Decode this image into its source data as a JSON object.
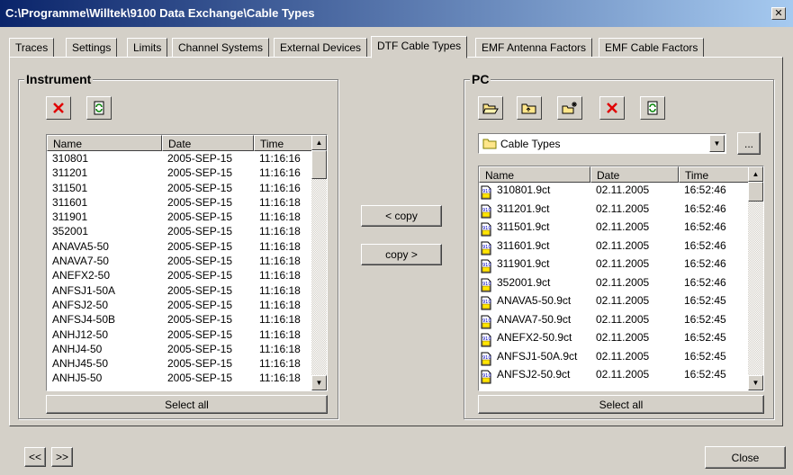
{
  "window": {
    "title": "C:\\Programme\\Willtek\\9100 Data Exchange\\Cable Types",
    "close_glyph": "✕"
  },
  "tabs": [
    {
      "label": "Traces"
    },
    {
      "label": "Settings"
    },
    {
      "label": "Limits"
    },
    {
      "label": "Channel Systems"
    },
    {
      "label": "External Devices"
    },
    {
      "label": "DTF Cable Types"
    },
    {
      "label": "EMF Antenna Factors"
    },
    {
      "label": "EMF Cable Factors"
    }
  ],
  "active_tab": "DTF Cable Types",
  "instrument": {
    "title": "Instrument",
    "columns": {
      "name": "Name",
      "date": "Date",
      "time": "Time"
    },
    "rows": [
      {
        "name": "310801",
        "date": "2005-SEP-15",
        "time": "11:16:16"
      },
      {
        "name": "311201",
        "date": "2005-SEP-15",
        "time": "11:16:16"
      },
      {
        "name": "311501",
        "date": "2005-SEP-15",
        "time": "11:16:16"
      },
      {
        "name": "311601",
        "date": "2005-SEP-15",
        "time": "11:16:18"
      },
      {
        "name": "311901",
        "date": "2005-SEP-15",
        "time": "11:16:18"
      },
      {
        "name": "352001",
        "date": "2005-SEP-15",
        "time": "11:16:18"
      },
      {
        "name": "ANAVA5-50",
        "date": "2005-SEP-15",
        "time": "11:16:18"
      },
      {
        "name": "ANAVA7-50",
        "date": "2005-SEP-15",
        "time": "11:16:18"
      },
      {
        "name": "ANEFX2-50",
        "date": "2005-SEP-15",
        "time": "11:16:18"
      },
      {
        "name": "ANFSJ1-50A",
        "date": "2005-SEP-15",
        "time": "11:16:18"
      },
      {
        "name": "ANFSJ2-50",
        "date": "2005-SEP-15",
        "time": "11:16:18"
      },
      {
        "name": "ANFSJ4-50B",
        "date": "2005-SEP-15",
        "time": "11:16:18"
      },
      {
        "name": "ANHJ12-50",
        "date": "2005-SEP-15",
        "time": "11:16:18"
      },
      {
        "name": "ANHJ4-50",
        "date": "2005-SEP-15",
        "time": "11:16:18"
      },
      {
        "name": "ANHJ45-50",
        "date": "2005-SEP-15",
        "time": "11:16:18"
      },
      {
        "name": "ANHJ5-50",
        "date": "2005-SEP-15",
        "time": "11:16:18"
      }
    ],
    "select_all": "Select all"
  },
  "transfer": {
    "copy_left": "< copy",
    "copy_right": "copy >"
  },
  "pc": {
    "title": "PC",
    "folder": "Cable Types",
    "browse": "...",
    "columns": {
      "name": "Name",
      "date": "Date",
      "time": "Time"
    },
    "rows": [
      {
        "name": "310801.9ct",
        "date": "02.11.2005",
        "time": "16:52:46"
      },
      {
        "name": "311201.9ct",
        "date": "02.11.2005",
        "time": "16:52:46"
      },
      {
        "name": "311501.9ct",
        "date": "02.11.2005",
        "time": "16:52:46"
      },
      {
        "name": "311601.9ct",
        "date": "02.11.2005",
        "time": "16:52:46"
      },
      {
        "name": "311901.9ct",
        "date": "02.11.2005",
        "time": "16:52:46"
      },
      {
        "name": "352001.9ct",
        "date": "02.11.2005",
        "time": "16:52:46"
      },
      {
        "name": "ANAVA5-50.9ct",
        "date": "02.11.2005",
        "time": "16:52:45"
      },
      {
        "name": "ANAVA7-50.9ct",
        "date": "02.11.2005",
        "time": "16:52:45"
      },
      {
        "name": "ANEFX2-50.9ct",
        "date": "02.11.2005",
        "time": "16:52:45"
      },
      {
        "name": "ANFSJ1-50A.9ct",
        "date": "02.11.2005",
        "time": "16:52:45"
      },
      {
        "name": "ANFSJ2-50.9ct",
        "date": "02.11.2005",
        "time": "16:52:45"
      }
    ],
    "select_all": "Select all"
  },
  "footer": {
    "prev": "<<",
    "next": ">>",
    "close": "Close"
  },
  "colors": {
    "face": "#d4d0c8",
    "title_start": "#0a246a",
    "title_end": "#a6caf0",
    "delete_red": "#e00000",
    "folder_yellow": "#ffe68a"
  }
}
